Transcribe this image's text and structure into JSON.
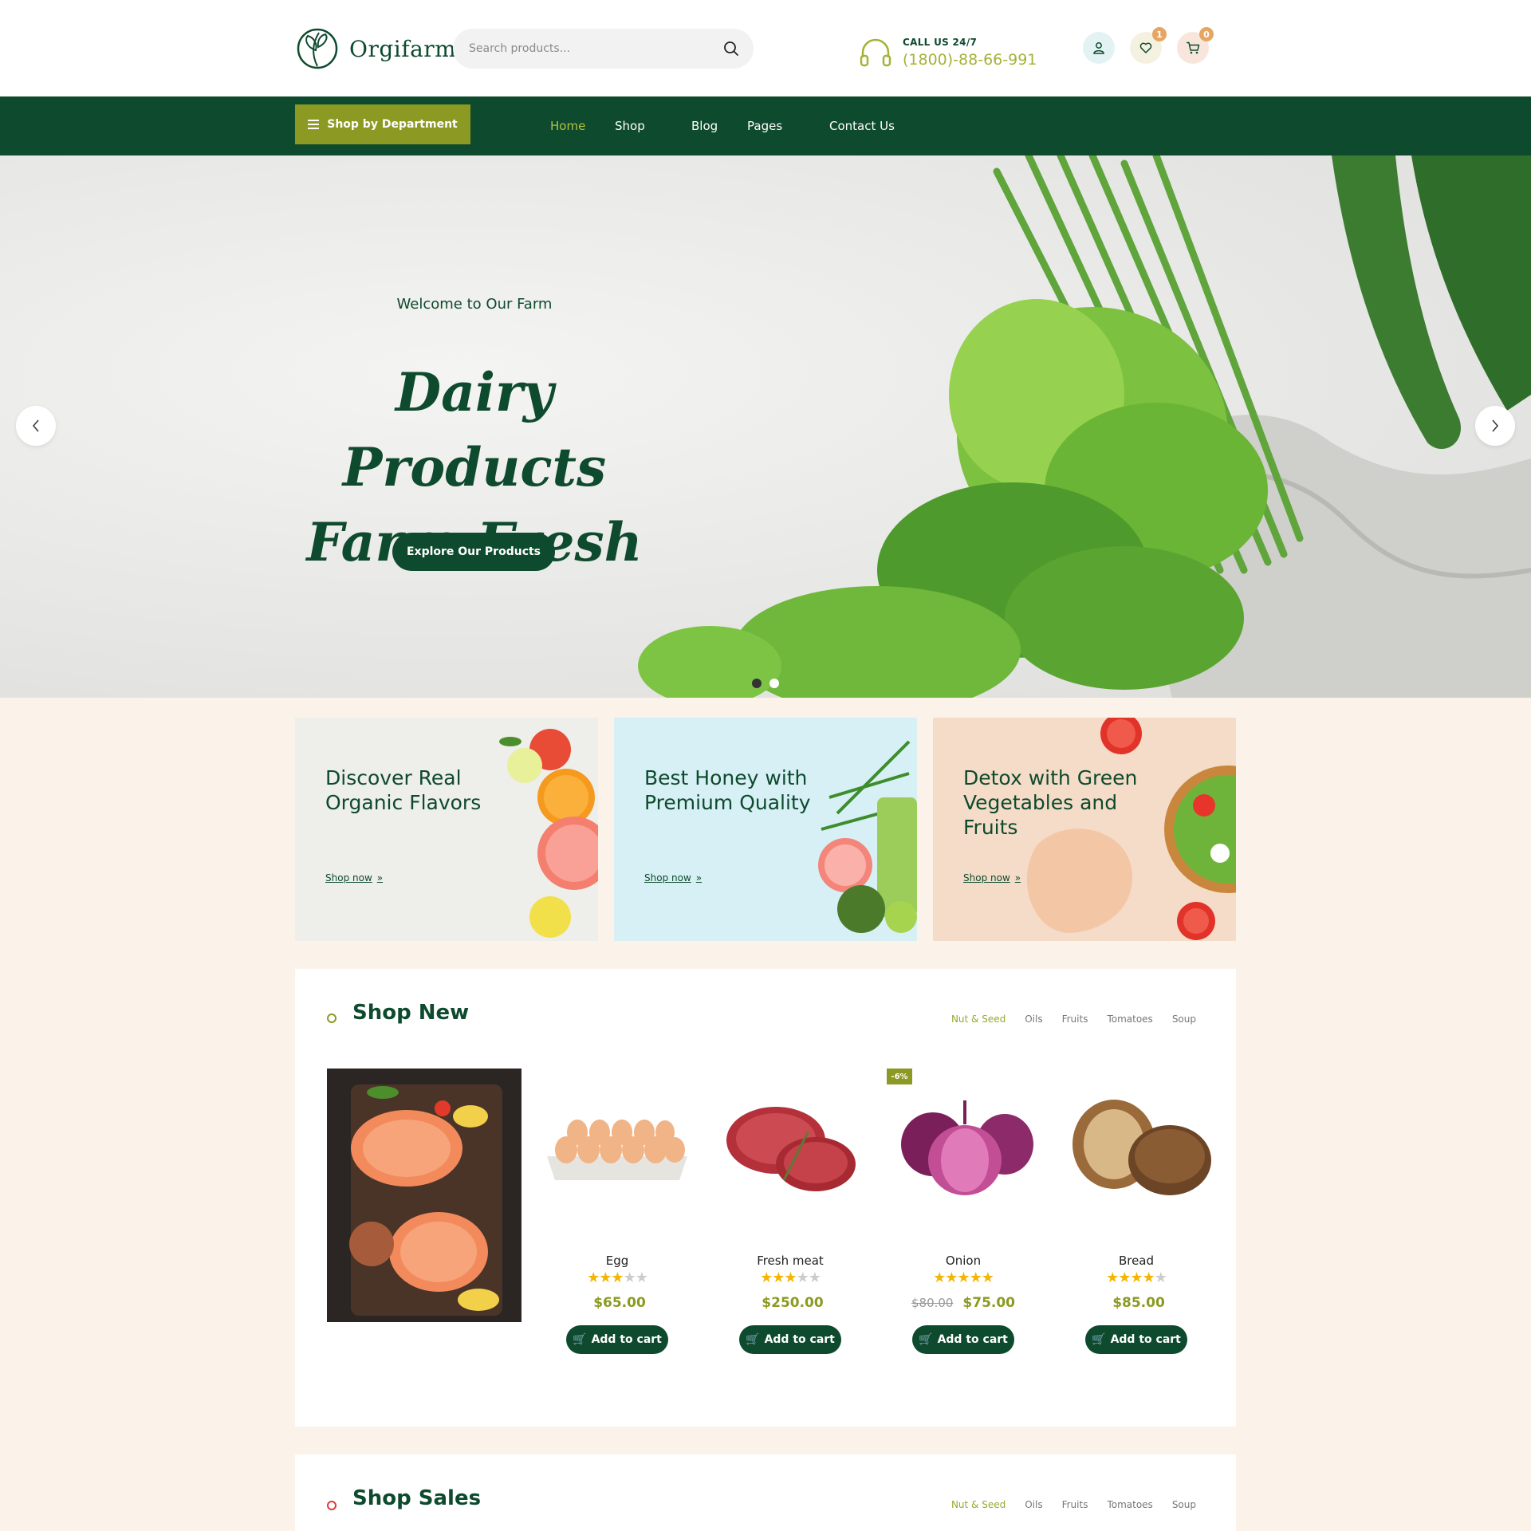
{
  "header": {
    "brand": "Orgifarm",
    "search": {
      "placeholder": "Search products...",
      "value": ""
    },
    "call_label": "CALL US 24/7",
    "call_number": "(1800)-88-66-991",
    "wishlist_count": "1",
    "cart_count": "0"
  },
  "nav": {
    "department_label": "Shop by Department",
    "items": [
      {
        "label": "Home",
        "active": true
      },
      {
        "label": "Shop"
      },
      {
        "label": "Blog"
      },
      {
        "label": "Pages"
      },
      {
        "label": "Contact Us"
      }
    ]
  },
  "hero": {
    "welcome": "Welcome to Our Farm",
    "title_line1": "Dairy Products",
    "title_line2": "Farm Fresh",
    "button": "Explore Our Products",
    "active_slide": 1,
    "slide_count": 2
  },
  "promos": [
    {
      "title": "Discover Real Organic Flavors",
      "link": "Shop now",
      "bg": "#eeeeea"
    },
    {
      "title": "Best Honey with Premium Quality",
      "link": "Shop now",
      "bg": "#d7f0f5"
    },
    {
      "title": "Detox with Green Vegetables and Fruits",
      "link": "Shop now",
      "bg": "#f5dcc8"
    }
  ],
  "shop_new": {
    "title": "Shop New",
    "filters": [
      "Nut & Seed",
      "Oils",
      "Fruits",
      "Tomatoes",
      "Soup"
    ],
    "active_filter": "Nut & Seed",
    "products": [
      {
        "name": "Egg",
        "rating": 3,
        "price": "$65.00",
        "old_price": "",
        "tag": "",
        "button": "Add to cart"
      },
      {
        "name": "Fresh meat",
        "rating": 3,
        "price": "$250.00",
        "old_price": "",
        "tag": "",
        "button": "Add to cart"
      },
      {
        "name": "Onion",
        "rating": 5,
        "price": "$75.00",
        "old_price": "$80.00",
        "tag": "-6%",
        "button": "Add to cart"
      },
      {
        "name": "Bread",
        "rating": 4,
        "price": "$85.00",
        "old_price": "",
        "tag": "",
        "button": "Add to cart"
      }
    ]
  },
  "shop_sales": {
    "title": "Shop Sales",
    "filters": [
      "Nut & Seed",
      "Oils",
      "Fruits",
      "Tomatoes",
      "Soup"
    ],
    "active_filter": "Nut & Seed"
  },
  "colors": {
    "primary_green": "#0e4a2d",
    "olive_accent": "#8c9a23",
    "star": "#f4b400",
    "star_empty": "#cccccc",
    "badge": "#e6a563",
    "page_bg": "#fbf2ea"
  },
  "icons": [
    "search-icon",
    "headset-icon",
    "user-icon",
    "heart-icon",
    "cart-icon",
    "menu-icon",
    "chevron-left-icon",
    "chevron-right-icon",
    "double-chevron-icon"
  ]
}
